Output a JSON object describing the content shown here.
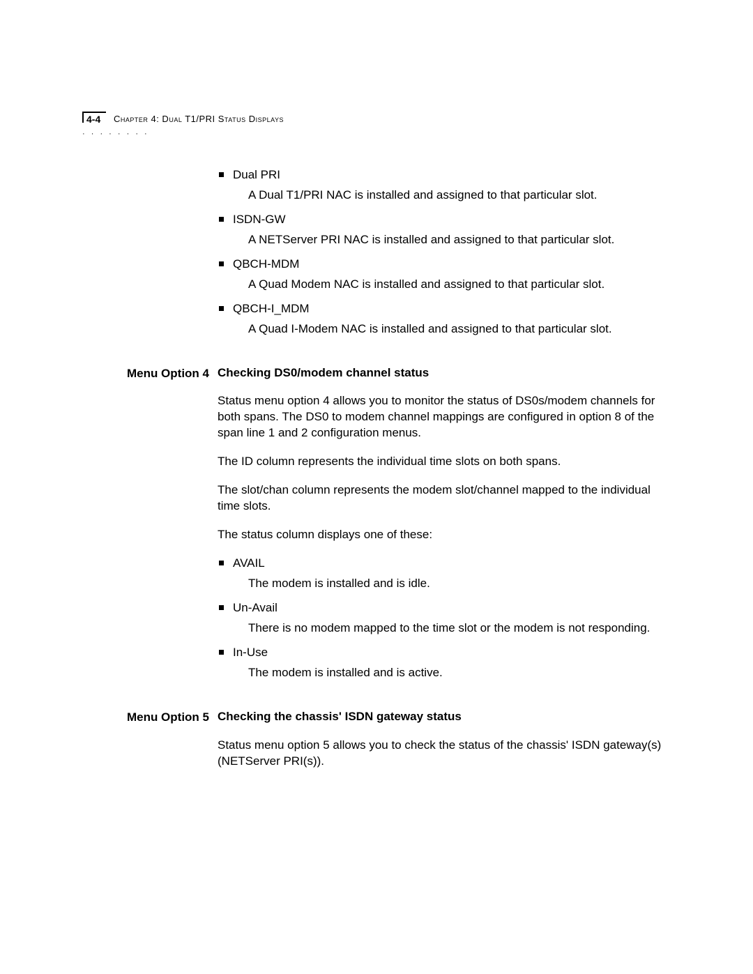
{
  "header": {
    "page_number": "4-4",
    "chapter": "Chapter 4: Dual T1/PRI Status Displays"
  },
  "top_list": [
    {
      "term": "Dual PRI",
      "desc": "A Dual T1/PRI NAC is installed and assigned to that particular slot."
    },
    {
      "term": "ISDN-GW",
      "desc": "A NETServer PRI NAC is installed and assigned to that particular slot."
    },
    {
      "term": "QBCH-MDM",
      "desc": "A Quad Modem NAC is installed and assigned to that particular slot."
    },
    {
      "term": "QBCH-I_MDM",
      "desc": "A Quad I-Modem NAC is installed and assigned to that particular slot."
    }
  ],
  "section4": {
    "label": "Menu Option 4",
    "heading": "Checking DS0/modem channel status",
    "p1": "Status menu option 4 allows you to monitor the status of DS0s/modem channels for both spans. The DS0 to modem channel mappings are configured in option 8 of the span line 1 and 2 configuration menus.",
    "p2": "The ID column represents the individual time slots on both spans.",
    "p3": "The slot/chan column represents the modem slot/channel mapped to the individual time slots.",
    "p4": "The status column displays one of these:",
    "list": [
      {
        "term": "AVAIL",
        "desc": "The modem is installed and is idle."
      },
      {
        "term": "Un-Avail",
        "desc": "There is no modem mapped to the time slot or the modem is not responding."
      },
      {
        "term": "In-Use",
        "desc": "The modem is installed and is active."
      }
    ]
  },
  "section5": {
    "label": "Menu Option 5",
    "heading": "Checking the chassis' ISDN gateway status",
    "p1": "Status menu option 5 allows you to check the status of the chassis' ISDN gateway(s) (NETServer PRI(s))."
  }
}
